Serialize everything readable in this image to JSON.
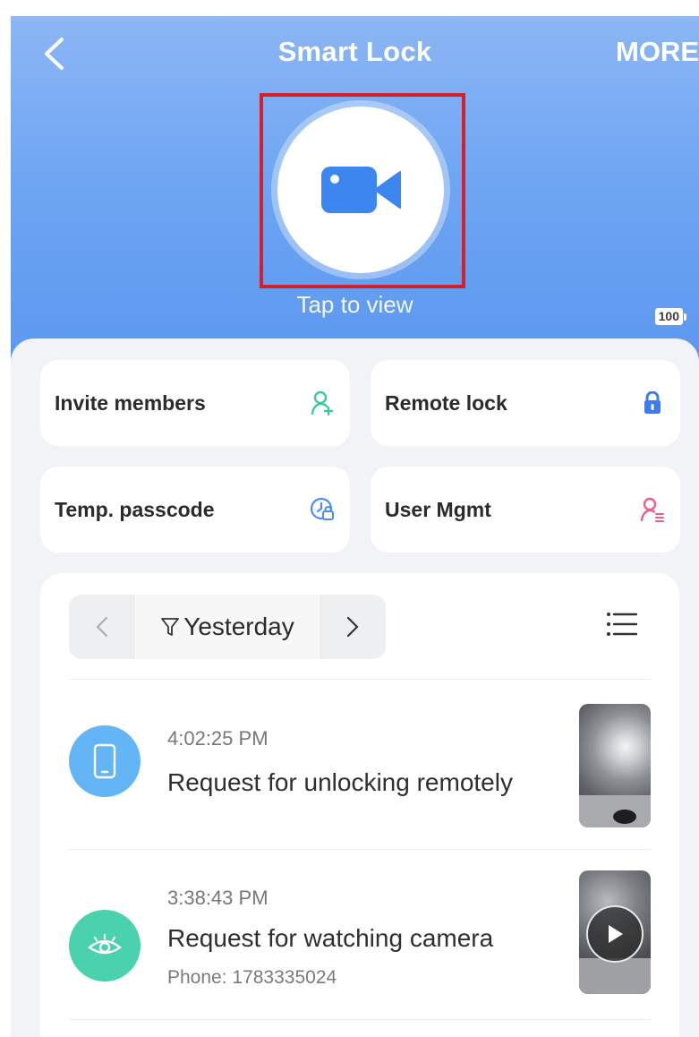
{
  "header": {
    "title": "Smart Lock",
    "more_label": "MORE",
    "camera_caption": "Tap to view",
    "battery_level": "100"
  },
  "actions": [
    {
      "label": "Invite members",
      "icon": "add-user-icon",
      "icon_color": "#3ec9a0"
    },
    {
      "label": "Remote lock",
      "icon": "lock-icon",
      "icon_color": "#3b7cf0"
    },
    {
      "label": "Temp. passcode",
      "icon": "clock-key-icon",
      "icon_color": "#4a8ef2"
    },
    {
      "label": "User Mgmt",
      "icon": "user-manage-icon",
      "icon_color": "#ec5f86"
    }
  ],
  "history": {
    "date_label": "Yesterday",
    "records": [
      {
        "time": "4:02:25 PM",
        "title": "Request for unlocking remotely",
        "subtitle": "",
        "icon": "phone-icon",
        "icon_color": "#64b5f6"
      },
      {
        "time": "3:38:43 PM",
        "title": "Request for watching camera",
        "subtitle": "Phone: 1783335024",
        "icon": "eye-icon",
        "icon_color": "#49d2ad"
      }
    ]
  },
  "colors": {
    "header_top": "#8cb6f4",
    "header_bottom": "#5a97f0",
    "camera_icon": "#3d86f0",
    "highlight_box": "#d4202c"
  }
}
